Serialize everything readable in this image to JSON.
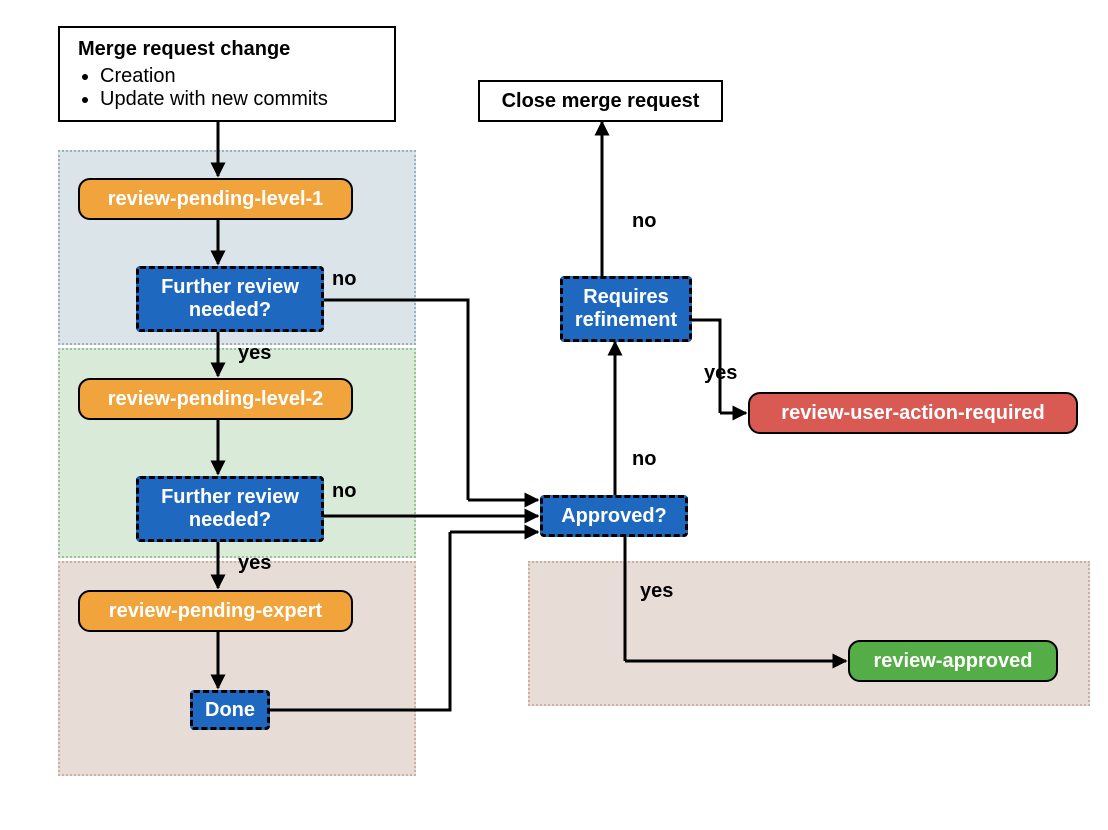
{
  "start": {
    "title": "Merge request change",
    "items": [
      "Creation",
      "Update with new commits"
    ]
  },
  "closeMergeRequest": "Close merge request",
  "states": {
    "pending1": "review-pending-level-1",
    "pending2": "review-pending-level-2",
    "pendingExpert": "review-pending-expert",
    "approvedState": "review-approved",
    "userAction": "review-user-action-required"
  },
  "decisions": {
    "further1": "Further review needed?",
    "further2": "Further review needed?",
    "approved": "Approved?",
    "refinement": "Requires refinement",
    "done": "Done"
  },
  "labels": {
    "yes": "yes",
    "no": "no"
  }
}
